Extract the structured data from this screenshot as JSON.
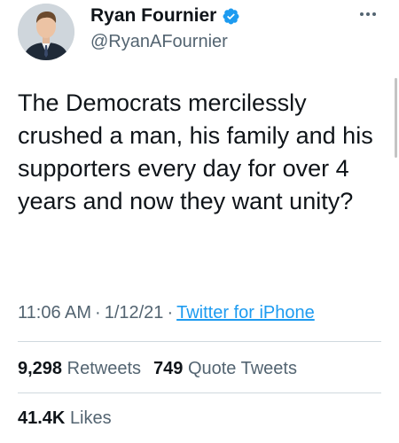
{
  "author": {
    "name": "Ryan Fournier",
    "handle": "@RyanAFournier",
    "verified": true
  },
  "menu_icon": "more-horizontal-icon",
  "tweet": {
    "text": "The Democrats mercilessly crushed a man, his family and his supporters every day for over 4 years and now they want unity?",
    "time": "11:06 AM",
    "separator": "·",
    "date": "1/12/21",
    "source": "Twitter for iPhone"
  },
  "stats": {
    "retweets_count": "9,298",
    "retweets_label": "Retweets",
    "quotes_count": "749",
    "quotes_label": "Quote Tweets",
    "likes_count": "41.4K",
    "likes_label": "Likes"
  },
  "colors": {
    "text": "#0f1419",
    "secondary": "#536471",
    "link": "#1d9bf0",
    "divider": "#cfd9de"
  }
}
